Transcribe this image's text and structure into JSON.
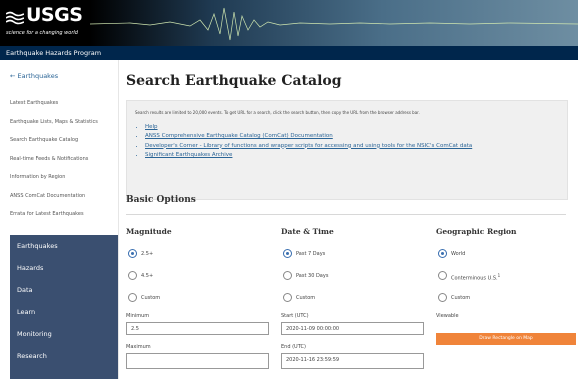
{
  "header": {
    "logo_name": "USGS",
    "logo_tagline": "science for a changing world",
    "program": "Earthquake Hazards Program"
  },
  "sidebar": {
    "back_label": "← Earthquakes",
    "links": [
      "Latest Earthquakes",
      "Earthquake Lists, Maps & Statistics",
      "Search Earthquake Catalog",
      "Real-time Feeds & Notifications",
      "Information by Region",
      "ANSS ComCat Documentation",
      "Errata for Latest Earthquakes"
    ],
    "nav": [
      "Earthquakes",
      "Hazards",
      "Data",
      "Learn",
      "Monitoring",
      "Research"
    ]
  },
  "main": {
    "title": "Search Earthquake Catalog",
    "info_note": "Search results are limited to 20,000 events. To get URL for a search, click the search button, then copy the URL from the browser address bar.",
    "info_links": [
      "Help",
      "ANSS Comprehensive Earthquake Catalog (ComCat) Documentation",
      "Developer's Corner - Library of functions and wrapper scripts for accessing and using tools for the NSIC's ComCat data",
      "Significant Earthquakes Archive"
    ],
    "section_title": "Basic Options",
    "magnitude": {
      "heading": "Magnitude",
      "options": [
        "2.5+",
        "4.5+",
        "Custom"
      ],
      "minimum_label": "Minimum",
      "minimum_value": "2.5",
      "maximum_label": "Maximum",
      "maximum_value": ""
    },
    "datetime": {
      "heading": "Date & Time",
      "options": [
        "Past 7 Days",
        "Past 30 Days",
        "Custom"
      ],
      "start_label": "Start (UTC)",
      "start_value": "2020-11-09 00:00:00",
      "end_label": "End (UTC)",
      "end_value": "2020-11-16 23:59:59"
    },
    "region": {
      "heading": "Geographic Region",
      "options": [
        "World",
        "Conterminous U.S.",
        "Custom"
      ],
      "options_sup": "1",
      "custom_hint": "Viewable",
      "draw_button": "Draw Rectangle on Map"
    }
  }
}
